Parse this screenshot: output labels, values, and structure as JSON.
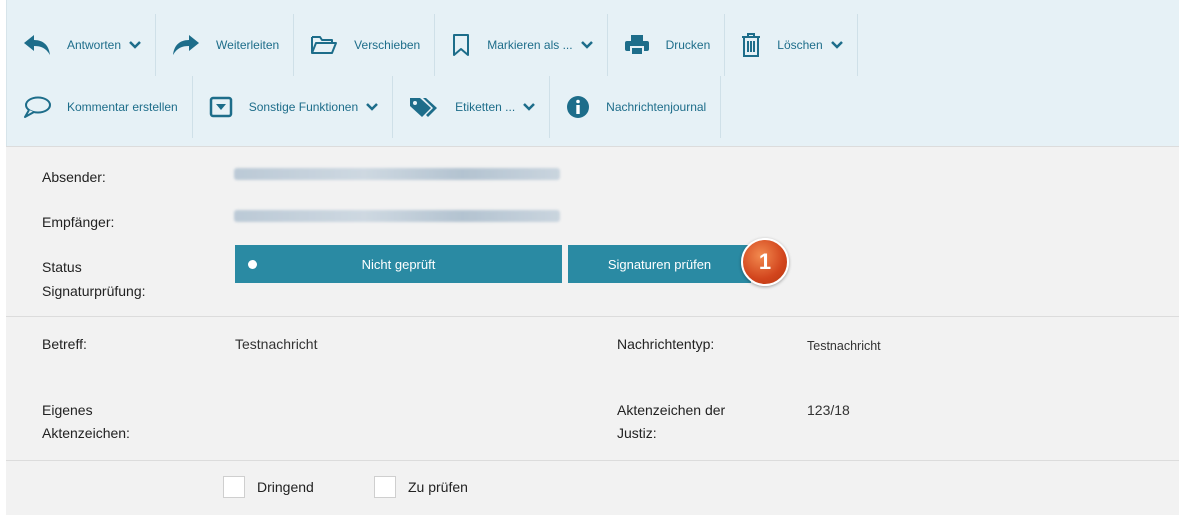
{
  "toolbar": {
    "row1": [
      {
        "label": "Antworten",
        "icon": "reply-icon",
        "dropdown": true
      },
      {
        "label": "Weiterleiten",
        "icon": "forward-icon",
        "dropdown": false
      },
      {
        "label": "Verschieben",
        "icon": "folder-icon",
        "dropdown": false
      },
      {
        "label": "Markieren als ...",
        "icon": "bookmark-icon",
        "dropdown": true
      },
      {
        "label": "Drucken",
        "icon": "printer-icon",
        "dropdown": false
      },
      {
        "label": "Löschen",
        "icon": "trash-icon",
        "dropdown": true
      }
    ],
    "row2": [
      {
        "label": "Kommentar erstellen",
        "icon": "comment-icon",
        "dropdown": false
      },
      {
        "label": "Sonstige Funktionen",
        "icon": "dropdown-box-icon",
        "dropdown": true
      },
      {
        "label": "Etiketten ...",
        "icon": "tags-icon",
        "dropdown": true
      },
      {
        "label": "Nachrichtenjournal",
        "icon": "info-icon",
        "dropdown": false
      }
    ]
  },
  "meta": {
    "sender_label": "Absender:",
    "recipient_label": "Empfänger:",
    "status_label_line1": "Status",
    "status_label_line2": "Signaturprüfung:",
    "status_value": "Nicht geprüft",
    "verify_button": "Signaturen prüfen",
    "marker_number": "1"
  },
  "subject": {
    "subject_label": "Betreff:",
    "subject_value": "Testnachricht",
    "type_label": "Nachrichtentyp:",
    "type_value": "Testnachricht",
    "own_ref_line1": "Eigenes",
    "own_ref_line2": "Aktenzeichen:",
    "court_ref_line1": "Aktenzeichen der",
    "court_ref_line2": "Justiz:",
    "court_ref_value": "123/18"
  },
  "flags": {
    "urgent_label": "Dringend",
    "check_label": "Zu prüfen"
  },
  "colors": {
    "accent": "#2a8aa3",
    "toolbar_bg": "#e6f1f6",
    "toolbar_text": "#1d6d8a",
    "marker": "#d2451d"
  }
}
